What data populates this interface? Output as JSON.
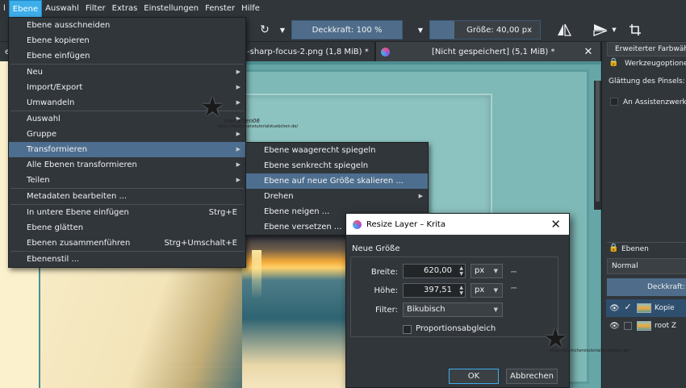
{
  "menubar": {
    "items": [
      "l",
      "Ebene",
      "Auswahl",
      "Filter",
      "Extras",
      "Einstellungen",
      "Fenster",
      "Hilfe"
    ]
  },
  "toolbar": {
    "opacity_label": "Deckkraft: 100 %",
    "size_label": "Größe: 40,00 px"
  },
  "tabs": [
    {
      "label": "-sharp-focus-2.png (1,8 MiB) *"
    },
    {
      "label": "[Nicht gespeichert]  (5,1 MiB) *"
    }
  ],
  "ebene_menu": {
    "items": [
      {
        "label": "Ebene ausschneiden",
        "shortcut": "",
        "submenu": false
      },
      {
        "label": "Ebene kopieren",
        "shortcut": "",
        "submenu": false
      },
      {
        "label": "Ebene einfügen",
        "shortcut": "",
        "submenu": false
      },
      {
        "sep": true
      },
      {
        "label": "Neu",
        "shortcut": "",
        "submenu": true
      },
      {
        "label": "Import/Export",
        "shortcut": "",
        "submenu": true
      },
      {
        "label": "Umwandeln",
        "shortcut": "",
        "submenu": true
      },
      {
        "sep": true
      },
      {
        "label": "Auswahl",
        "shortcut": "",
        "submenu": true
      },
      {
        "label": "Gruppe",
        "shortcut": "",
        "submenu": true
      },
      {
        "label": "Transformieren",
        "shortcut": "",
        "submenu": true,
        "highlighted": true
      },
      {
        "label": "Alle Ebenen transformieren",
        "shortcut": "",
        "submenu": true
      },
      {
        "label": "Teilen",
        "shortcut": "",
        "submenu": true
      },
      {
        "sep": true
      },
      {
        "label": "Metadaten bearbeiten ...",
        "shortcut": "",
        "submenu": false
      },
      {
        "sep": true
      },
      {
        "label": "In untere Ebene einfügen",
        "shortcut": "Strg+E",
        "submenu": false
      },
      {
        "label": "Ebene glätten",
        "shortcut": "",
        "submenu": false
      },
      {
        "label": "Ebenen zusammenführen",
        "shortcut": "Strg+Umschalt+E",
        "submenu": false
      },
      {
        "sep": true
      },
      {
        "label": "Ebenenstil ...",
        "shortcut": "",
        "submenu": false
      }
    ]
  },
  "transform_menu": {
    "items": [
      {
        "label": "Ebene waagerecht spiegeln",
        "submenu": false
      },
      {
        "label": "Ebene senkrecht spiegeln",
        "submenu": false
      },
      {
        "label": "Ebene auf neue Größe skalieren ...",
        "submenu": false,
        "highlighted": true
      },
      {
        "label": "Drehen",
        "submenu": true
      },
      {
        "label": "Ebene neigen ...",
        "submenu": false
      },
      {
        "label": "Ebene versetzen ...",
        "submenu": false
      }
    ]
  },
  "dock": {
    "tab_label": "Erweiterter Farbwäh",
    "tool_options": "Werkzeugoptione",
    "smoothing": "Glättung des Pinsels:",
    "assistant": "An Assistenzwerkz",
    "layers_title": "Ebenen",
    "blend_mode": "Normal",
    "opacity": "Deckkraft:",
    "layers": [
      {
        "name": "Kopie",
        "selected": true
      },
      {
        "name": "root Z",
        "selected": false
      }
    ]
  },
  "dialog": {
    "title": "Resize Layer – Krita",
    "group": "Neue Größe",
    "width_label": "Breite:",
    "width_value": "620,00",
    "height_label": "Höhe:",
    "height_value": "397,51",
    "unit": "px",
    "filter_label": "Filter:",
    "filter_value": "Bikubisch",
    "keep_ratio": "Proportionsabgleich",
    "ok": "OK",
    "cancel": "Abbrechen"
  },
  "watermark": {
    "name": "sternchen06",
    "url": "https://sternchenstutorialstuebchen.de/"
  },
  "colors": {
    "highlight": "#4d6e8f",
    "accent": "#3daee9",
    "slider": "#4f6d8a",
    "bg": "#31363b"
  }
}
